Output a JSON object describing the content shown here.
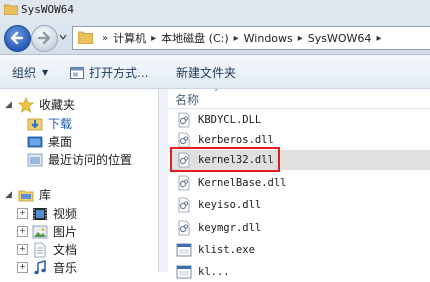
{
  "window": {
    "title": "SysWOW64"
  },
  "address": {
    "breadcrumbs": [
      "计算机",
      "本地磁盘 (C:)",
      "Windows",
      "SysWOW64"
    ],
    "leading_chevron": "»"
  },
  "toolbar": {
    "organize": "组织",
    "open_with": "打开方式...",
    "new_folder": "新建文件夹"
  },
  "nav": {
    "favorites": {
      "label": "收藏夹",
      "items": [
        "下载",
        "桌面",
        "最近访问的位置"
      ]
    },
    "libraries": {
      "label": "库",
      "items": [
        "视频",
        "图片",
        "文档",
        "音乐"
      ]
    }
  },
  "files": {
    "column_name": "名称",
    "items": [
      {
        "name": "KBDYCL.DLL",
        "type": "dll"
      },
      {
        "name": "kerberos.dll",
        "type": "dll"
      },
      {
        "name": "kernel32.dll",
        "type": "dll",
        "selected": true
      },
      {
        "name": "KernelBase.dll",
        "type": "dll"
      },
      {
        "name": "keyiso.dll",
        "type": "dll"
      },
      {
        "name": "keymgr.dll",
        "type": "dll"
      },
      {
        "name": "klist.exe",
        "type": "exe"
      },
      {
        "name": "kl...",
        "type": "exe"
      }
    ]
  },
  "colors": {
    "highlight_border": "#e02020",
    "selected_row": "#e0e0e0"
  }
}
